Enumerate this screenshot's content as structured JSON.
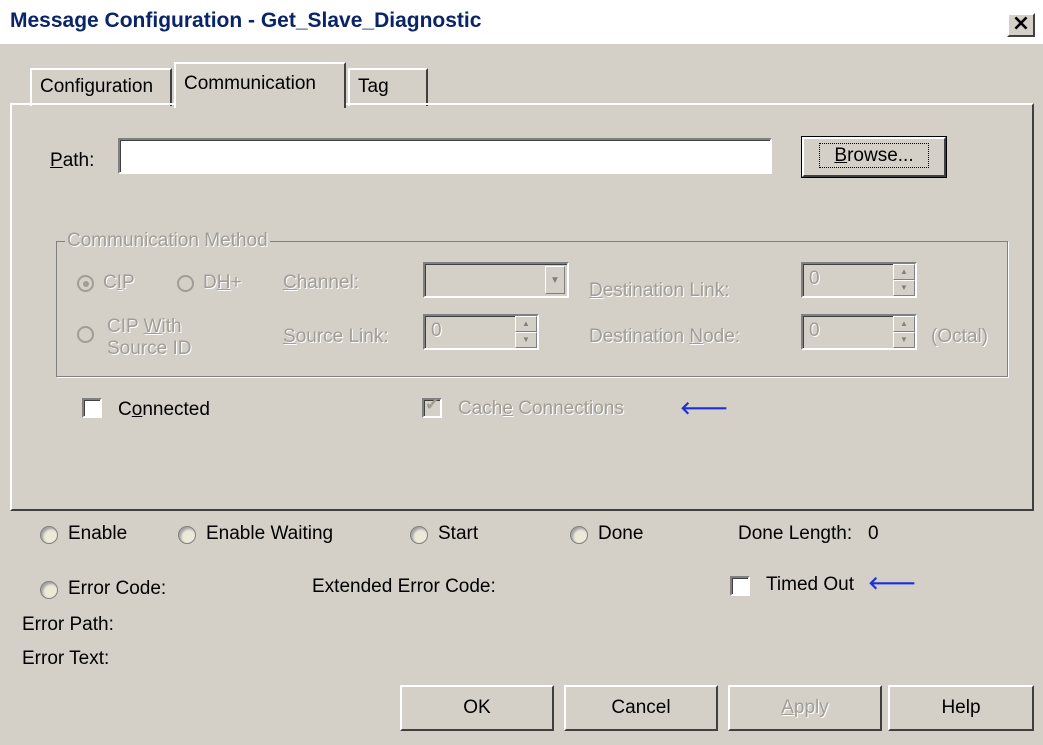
{
  "window": {
    "title": "Message Configuration - Get_Slave_Diagnostic",
    "close": "×"
  },
  "tabs": [
    {
      "label": "Configuration"
    },
    {
      "label": "Communication"
    },
    {
      "label": "Tag"
    }
  ],
  "path": {
    "label_prefix": "P",
    "label_rest": "ath:",
    "value": ""
  },
  "browse": {
    "label_prefix": "B",
    "label_rest": "rowse..."
  },
  "comm_method": {
    "title": "Communication Method",
    "cip": {
      "p1": "C",
      "u": "I",
      "p2": "P",
      "checked": true
    },
    "dhplus": {
      "p1": "D",
      "u": "H",
      "p2": "+"
    },
    "cip_source": {
      "line1_p1": "CIP ",
      "line1_u": "W",
      "line1_p2": "ith",
      "line2": "Source ID"
    },
    "channel": {
      "u": "C",
      "rest": "hannel:",
      "value": ""
    },
    "source_link": {
      "u": "S",
      "rest": "ource Link:",
      "value": "0"
    },
    "dest_link": {
      "u": "D",
      "rest": "estination Link:",
      "value": "0"
    },
    "dest_node": {
      "p1": "Destination ",
      "u": "N",
      "p2": "ode:",
      "value": "0"
    },
    "octal": "(Octal)"
  },
  "connected": {
    "p1": "C",
    "u": "o",
    "p2": "nnected",
    "checked": false
  },
  "cache": {
    "p1": "Cach",
    "u": "e",
    "p2": " Connections",
    "checked": true
  },
  "status": {
    "enable": "Enable",
    "enable_waiting": "Enable Waiting",
    "start": "Start",
    "done": "Done",
    "done_length_label": "Done Length:",
    "done_length_value": "0",
    "error_code": "Error Code:",
    "extended_error_code": "Extended Error Code:",
    "timed_out": "Timed Out",
    "error_path": "Error Path:",
    "error_text": "Error Text:"
  },
  "buttons": {
    "ok": "OK",
    "cancel": "Cancel",
    "apply_u": "A",
    "apply_rest": "pply",
    "help": "Help"
  },
  "colors": {
    "title_text": "#0a246a",
    "arrow": "#1e2fd8",
    "disabled_text": "#a09d96",
    "face": "#d4d0c8"
  }
}
